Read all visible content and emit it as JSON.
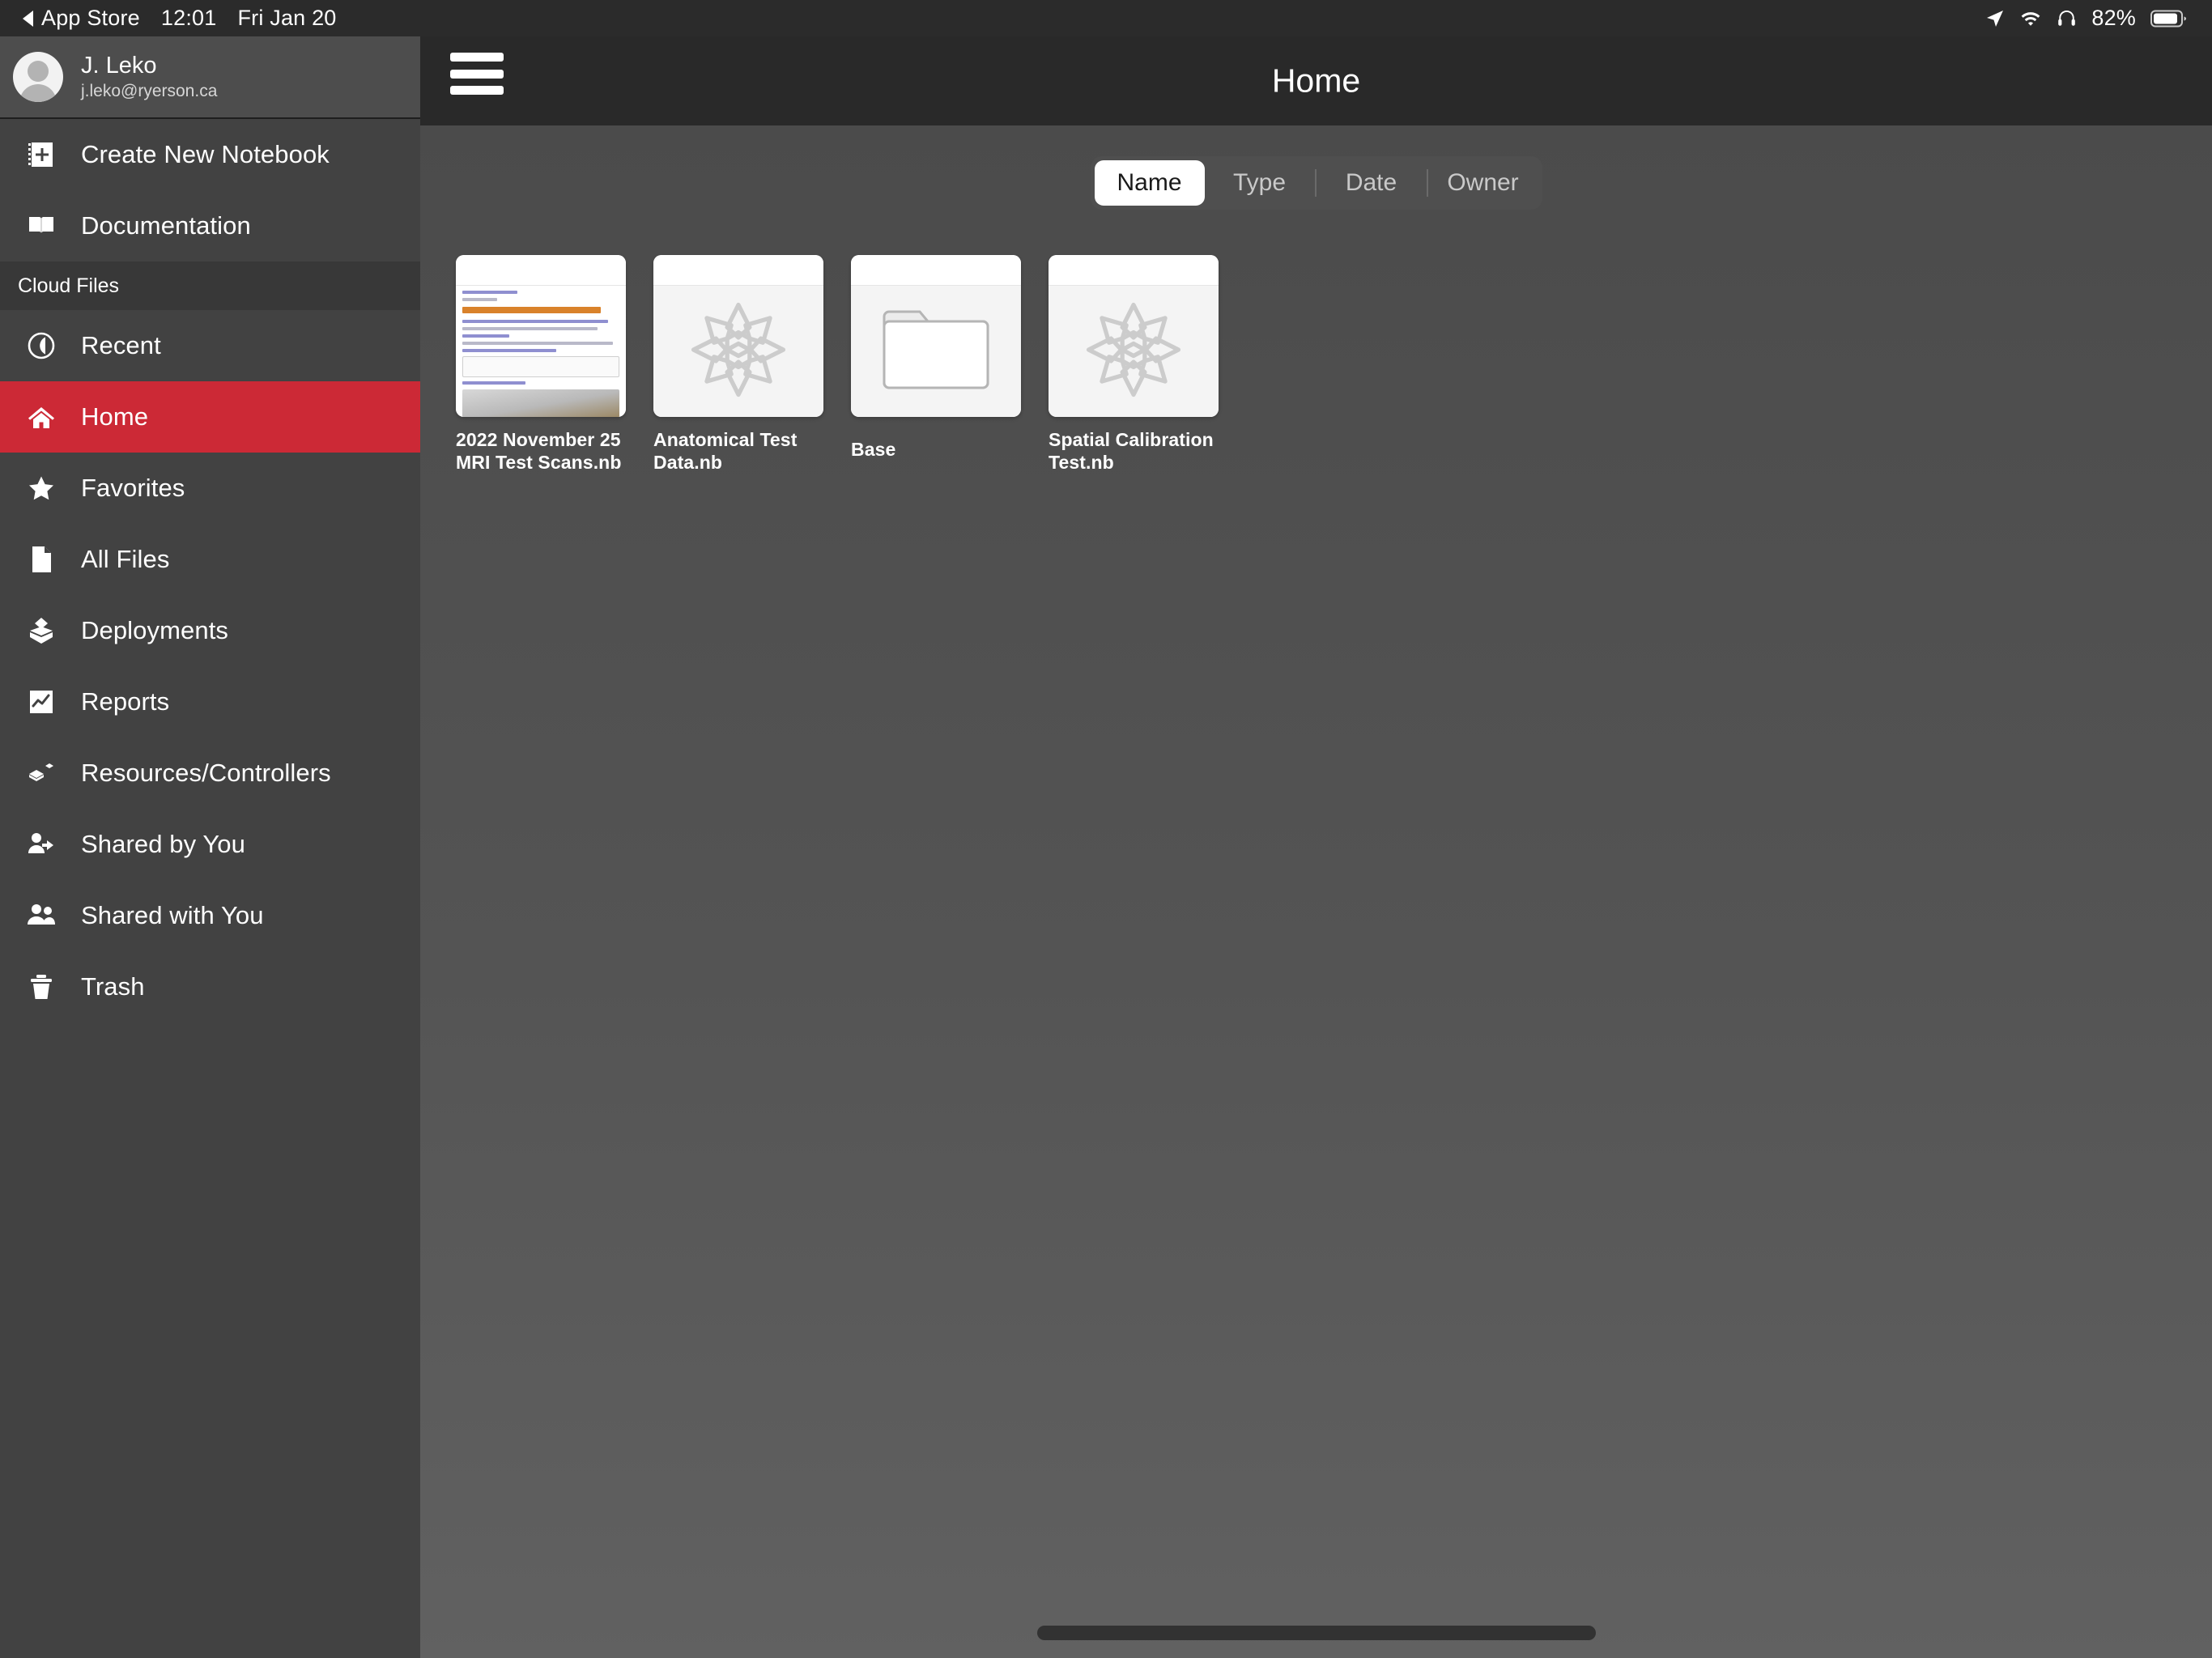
{
  "status_bar": {
    "back_label": "App Store",
    "time": "12:01",
    "date": "Fri Jan 20",
    "battery_percent": "82%",
    "icons": [
      "location-arrow-icon",
      "wifi-icon",
      "headphones-icon",
      "battery-icon"
    ]
  },
  "profile": {
    "name": "J. Leko",
    "email": "j.leko@ryerson.ca",
    "avatar": "user-avatar"
  },
  "sidebar": {
    "top_items": [
      {
        "label": "Create New Notebook",
        "icon": "new-notebook-icon"
      },
      {
        "label": "Documentation",
        "icon": "book-icon"
      }
    ],
    "section_label": "Cloud Files",
    "items": [
      {
        "label": "Recent",
        "icon": "clock-back-icon",
        "active": false
      },
      {
        "label": "Home",
        "icon": "home-icon",
        "active": true
      },
      {
        "label": "Favorites",
        "icon": "star-icon",
        "active": false
      },
      {
        "label": "All Files",
        "icon": "document-icon",
        "active": false
      },
      {
        "label": "Deployments",
        "icon": "deployment-box-icon",
        "active": false
      },
      {
        "label": "Reports",
        "icon": "chart-icon",
        "active": false
      },
      {
        "label": "Resources/Controllers",
        "icon": "resources-icon",
        "active": false
      },
      {
        "label": "Shared by You",
        "icon": "person-arrow-icon",
        "active": false
      },
      {
        "label": "Shared with You",
        "icon": "people-icon",
        "active": false
      },
      {
        "label": "Trash",
        "icon": "trash-icon",
        "active": false
      }
    ],
    "active_color": "#cc2936"
  },
  "header": {
    "title": "Home",
    "menu_icon": "hamburger-menu-icon"
  },
  "sort_control": {
    "options": [
      "Name",
      "Type",
      "Date",
      "Owner"
    ],
    "selected": "Name"
  },
  "files": [
    {
      "name": "2022 November 25 MRI Test Scans.nb",
      "thumbnail": "notebook-preview",
      "type": "notebook"
    },
    {
      "name": "Anatomical Test Data.nb",
      "thumbnail": "wolfram-spikey-icon",
      "type": "notebook"
    },
    {
      "name": "Base",
      "thumbnail": "folder-icon",
      "type": "folder"
    },
    {
      "name": "Spatial Calibration Test.nb",
      "thumbnail": "wolfram-spikey-icon",
      "type": "notebook"
    }
  ],
  "home_indicator": "home-indicator-bar"
}
